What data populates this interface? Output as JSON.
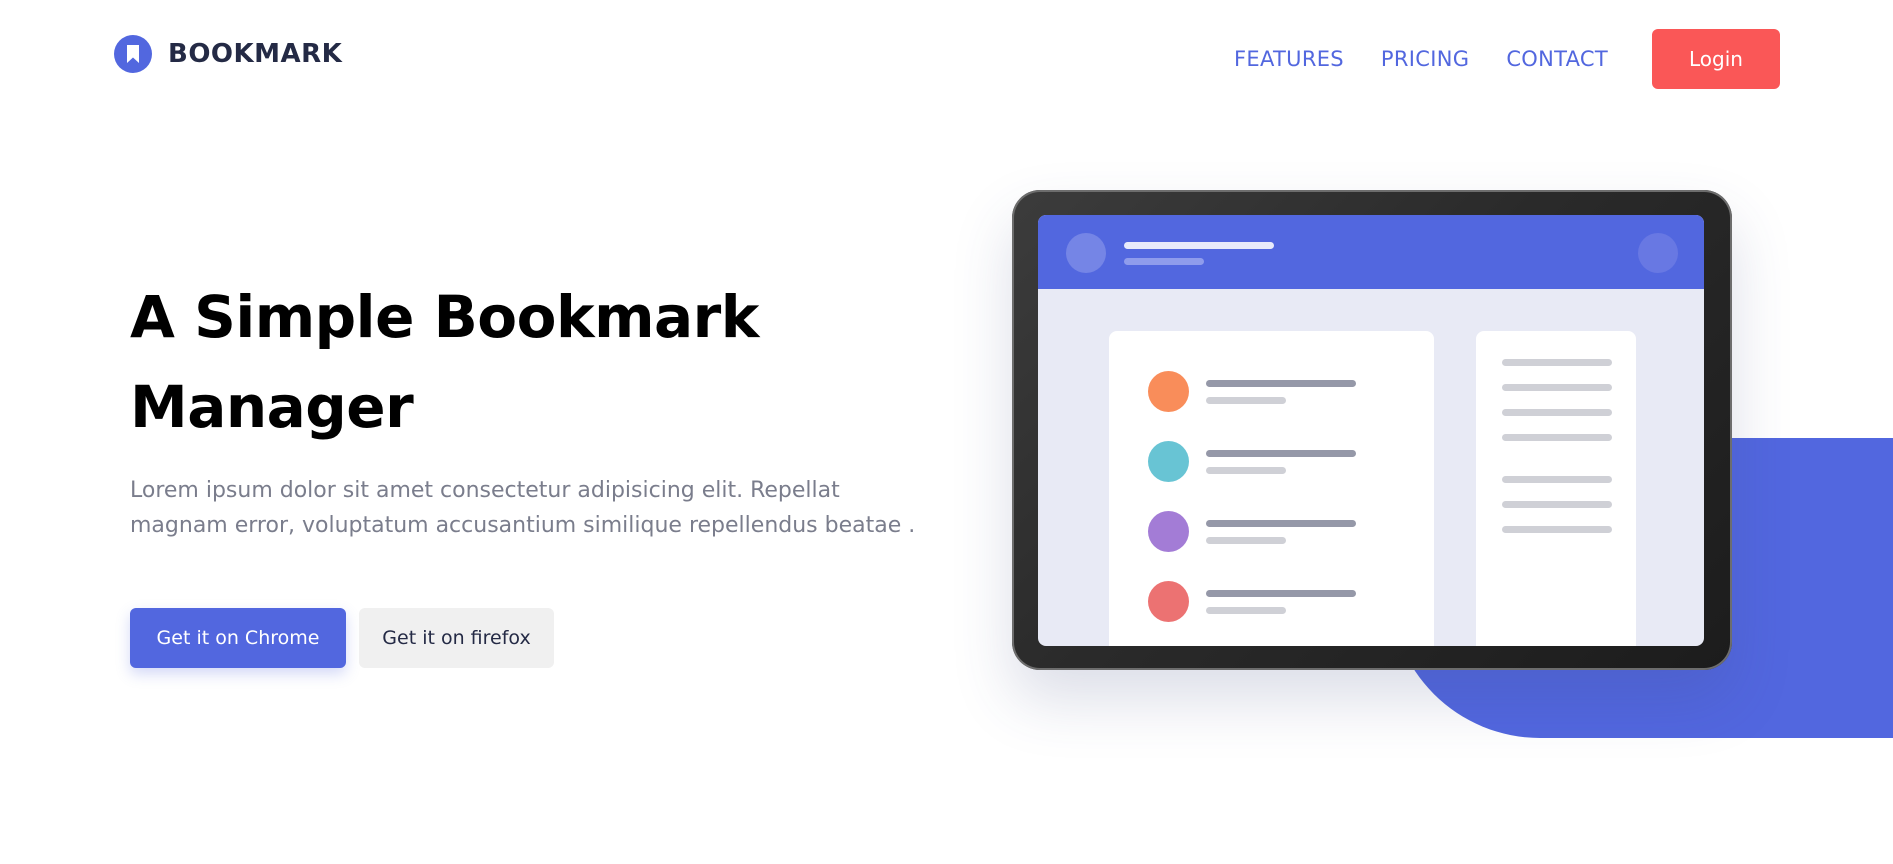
{
  "brand": {
    "name": "BOOKMARK",
    "color": "#5267df",
    "text_color": "#242a45"
  },
  "nav": {
    "links": [
      "FEATURES",
      "PRICING",
      "CONTACT"
    ],
    "login_label": "Login",
    "login_color": "#fa5757"
  },
  "hero": {
    "title": "A Simple Bookmark Manager",
    "description": "Lorem ipsum dolor sit amet consectetur adipisicing elit. Repellat magnam error, voluptatum accusantium similique repellendus beatae .",
    "primary_button": "Get it on Chrome",
    "secondary_button": "Get it on firefox"
  },
  "illustration": {
    "accent_color": "#5267df",
    "bookmark_dot_colors": [
      "#f98d5a",
      "#68c4d4",
      "#a37cd6",
      "#ec7272"
    ]
  },
  "icons": {
    "logo": "bookmark-icon"
  }
}
